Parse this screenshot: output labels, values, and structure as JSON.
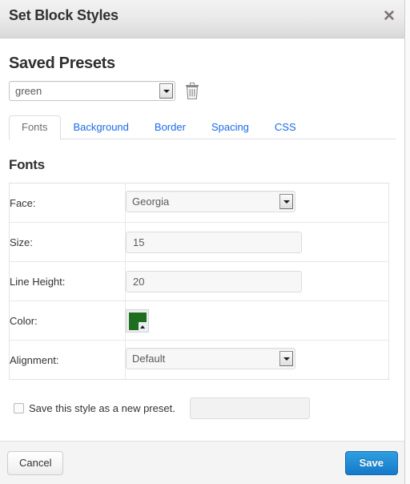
{
  "modal": {
    "title": "Set Block Styles",
    "close_icon": "close-icon"
  },
  "presets": {
    "heading": "Saved Presets",
    "selected": "green",
    "delete_icon": "trash-icon"
  },
  "tabs": [
    {
      "label": "Fonts",
      "active": true
    },
    {
      "label": "Background",
      "active": false
    },
    {
      "label": "Border",
      "active": false
    },
    {
      "label": "Spacing",
      "active": false
    },
    {
      "label": "CSS",
      "active": false
    }
  ],
  "fonts": {
    "heading": "Fonts",
    "rows": [
      {
        "label": "Face:",
        "type": "select",
        "value": "Georgia"
      },
      {
        "label": "Size:",
        "type": "text",
        "value": "15"
      },
      {
        "label": "Line Height:",
        "type": "text",
        "value": "20"
      },
      {
        "label": "Color:",
        "type": "color",
        "value": "#1f6e1f"
      },
      {
        "label": "Alignment:",
        "type": "select",
        "value": "Default"
      }
    ]
  },
  "save_preset": {
    "label": "Save this style as a new preset.",
    "checked": false,
    "name_value": "",
    "name_placeholder": ""
  },
  "footer": {
    "cancel_label": "Cancel",
    "save_label": "Save"
  },
  "colors": {
    "link": "#1a6ae8",
    "primary_button": "#1579c9",
    "swatch_green": "#1f6e1f"
  }
}
